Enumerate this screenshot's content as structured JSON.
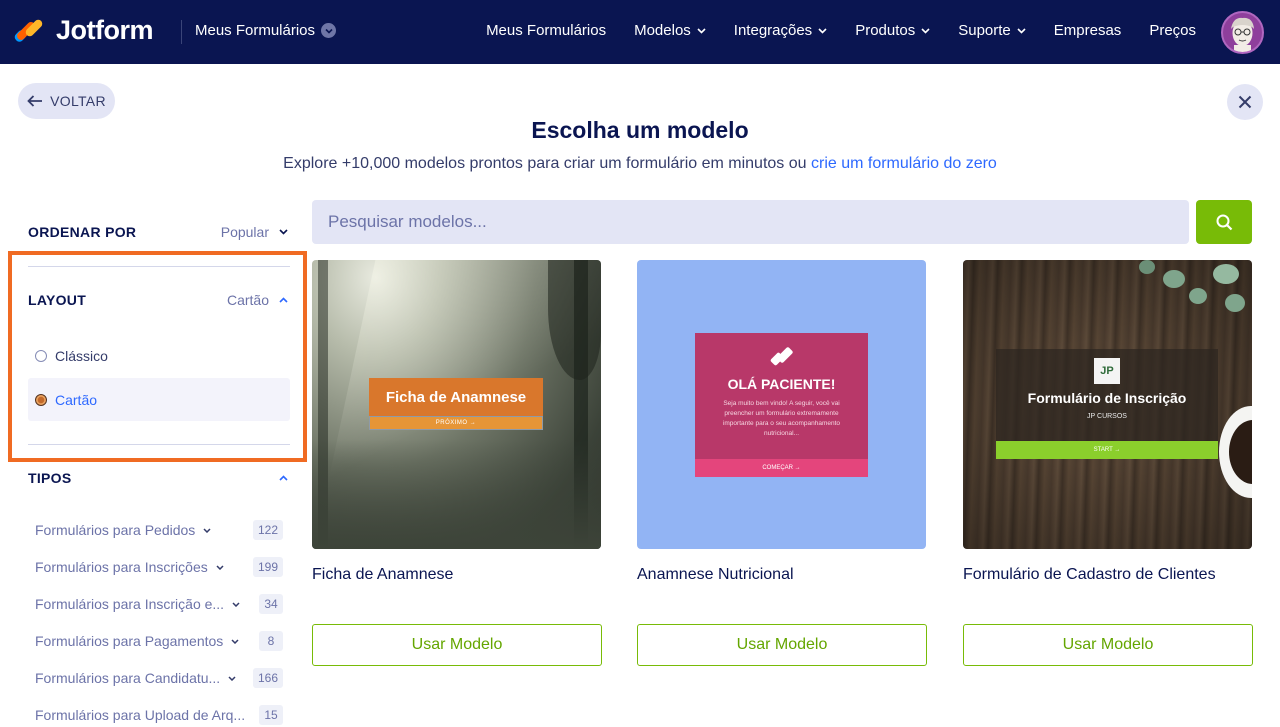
{
  "header": {
    "brand": "Jotform",
    "my_forms": "Meus Formulários",
    "nav": [
      "Meus Formulários",
      "Modelos",
      "Integrações",
      "Produtos",
      "Suporte",
      "Empresas",
      "Preços"
    ]
  },
  "back_label": "VOLTAR",
  "title": "Escolha um modelo",
  "subtitle_text": "Explore +10,000 modelos prontos para criar um formulário em minutos ou ",
  "subtitle_link": "crie um formulário do zero",
  "sidebar": {
    "sort_label": "ORDENAR POR",
    "sort_value": "Popular",
    "layout_label": "LAYOUT",
    "layout_value": "Cartão",
    "layout_options": [
      "Clássico",
      "Cartão"
    ],
    "types_label": "TIPOS",
    "types": [
      {
        "label": "Formulários para Pedidos",
        "count": "122"
      },
      {
        "label": "Formulários para Inscrições",
        "count": "199"
      },
      {
        "label": "Formulários para Inscrição e...",
        "count": "34"
      },
      {
        "label": "Formulários para Pagamentos",
        "count": "8"
      },
      {
        "label": "Formulários para Candidatu...",
        "count": "166"
      },
      {
        "label": "Formulários para Upload de Arq...",
        "count": "15"
      }
    ]
  },
  "search": {
    "placeholder": "Pesquisar modelos..."
  },
  "cards": [
    {
      "title": "Ficha de Anamnese",
      "button": "Usar Modelo",
      "thumb_heading": "Ficha de Anamnese",
      "thumb_button": "PRÓXIMO →"
    },
    {
      "title": "Anamnese Nutricional",
      "button": "Usar Modelo",
      "thumb_heading": "OLÁ PACIENTE!",
      "thumb_text": "Seja muito bem vindo! A seguir, você vai preencher um formulário extremamente importante para o seu acompanhamento nutricional...",
      "thumb_button": "COMEÇAR →"
    },
    {
      "title": "Formulário de Cadastro de Clientes",
      "button": "Usar Modelo",
      "thumb_logo": "JP",
      "thumb_heading": "Formulário de Inscrição",
      "thumb_sub": "JP CURSOS",
      "thumb_button": "START →"
    }
  ],
  "colors": {
    "header_bg": "#0a1551",
    "accent_green": "#78bb07",
    "link_blue": "#2e69ff",
    "highlight_orange": "#f06b23"
  }
}
